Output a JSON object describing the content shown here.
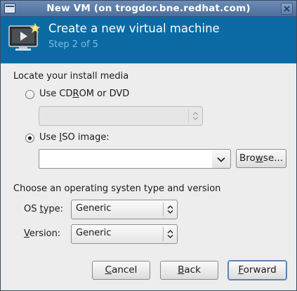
{
  "window": {
    "title": "New VM (on trogdor.bne.redhat.com)"
  },
  "banner": {
    "heading": "Create a new virtual machine",
    "step": "Step 2 of 5",
    "icon": "vm-monitor-icon"
  },
  "install_media": {
    "section_label": "Locate your install media",
    "cdrom_option": {
      "label_pre": "Use CD",
      "label_mnemonic": "R",
      "label_post": "OM or DVD",
      "selected": false
    },
    "cdrom_combo": {
      "value": "",
      "enabled": false
    },
    "iso_option": {
      "label_pre": "Use ",
      "label_mnemonic": "I",
      "label_post": "SO image:",
      "selected": true
    },
    "iso_path": {
      "value": ""
    },
    "browse_button": {
      "label_pre": "Bro",
      "label_mnemonic": "w",
      "label_post": "se..."
    }
  },
  "os_section": {
    "section_label": "Choose an operating systen type and version",
    "os_type": {
      "label_pre": "OS ",
      "label_mnemonic": "t",
      "label_post": "ype:",
      "value": "Generic"
    },
    "version": {
      "label_pre": "",
      "label_mnemonic": "V",
      "label_post": "ersion:",
      "value": "Generic"
    }
  },
  "actions": {
    "cancel": {
      "label_pre": "",
      "label_mnemonic": "C",
      "label_post": "ancel"
    },
    "back": {
      "label_pre": "",
      "label_mnemonic": "B",
      "label_post": "ack"
    },
    "forward": {
      "label_pre": "",
      "label_mnemonic": "F",
      "label_post": "orward"
    }
  },
  "colors": {
    "banner_bg": "#0b6aa3",
    "step_text": "#7fbde0",
    "titlebar": "#5b7ca8"
  }
}
